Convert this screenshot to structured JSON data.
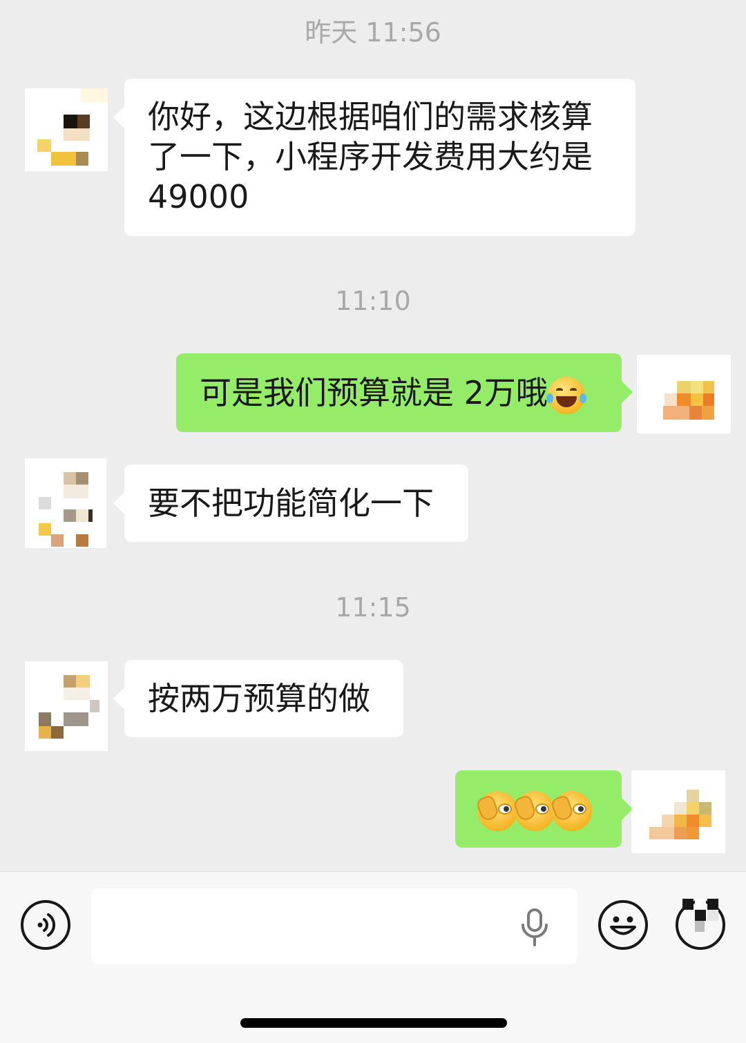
{
  "chat": {
    "timestamps": [
      "昨天 11:56",
      "11:10",
      "11:15"
    ],
    "messages": [
      {
        "direction": "incoming",
        "lines": [
          "你好，这边根据咱们的需求核算",
          "了一下，小程序开发费用大约是",
          "49000"
        ]
      },
      {
        "direction": "outgoing",
        "text": "可是我们预算就是 2万哦",
        "emoji": "face-with-tears-of-joy"
      },
      {
        "direction": "incoming",
        "text": "要不把功能简化一下"
      },
      {
        "direction": "incoming",
        "text": "按两万预算的做"
      },
      {
        "direction": "outgoing",
        "emoji_sequence": [
          "peeking-eye-emoji",
          "peeking-eye-emoji",
          "peeking-eye-emoji"
        ]
      }
    ]
  },
  "input_bar": {
    "voice_toggle_icon": "voice-icon",
    "text_value": "",
    "mic_icon": "microphone-icon",
    "emoji_icon": "smiley-icon",
    "more_icon": "plus-circle-icon"
  },
  "colors": {
    "background": "#ededed",
    "incoming_bubble": "#ffffff",
    "outgoing_bubble": "#95ec69",
    "timestamp": "#a8a8a8"
  }
}
